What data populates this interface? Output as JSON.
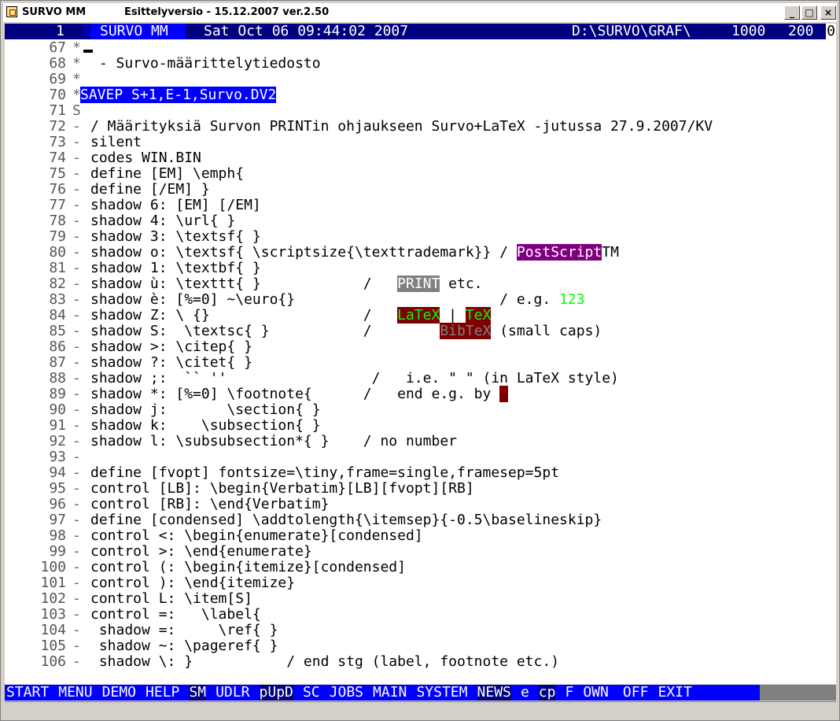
{
  "window": {
    "title_left": "SURVO MM",
    "title_center": "Esittelyversio  - 15.12.2007 ver.2.50",
    "minimize_label": "_",
    "maximize_label": "□",
    "close_label": "×"
  },
  "status_line": {
    "line_number": "1",
    "marker": "1",
    "app_name": "SURVO MM",
    "datetime": "Sat Oct 06 09:44:02 2007",
    "path": "D:\\SURVO\\GRAF\\",
    "col1": "1000",
    "col2": "200",
    "mode": "0"
  },
  "lines": [
    {
      "n": "67",
      "c": "*",
      "t": ""
    },
    {
      "n": "68",
      "c": "*",
      "t": " - Survo-määrittelytiedosto"
    },
    {
      "n": "69",
      "c": "*",
      "t": ""
    },
    {
      "n": "70",
      "c": "*",
      "t": "SAVEP S+1,E-1,Survo.DV2"
    },
    {
      "n": "71",
      "c": "S",
      "t": ""
    },
    {
      "n": "72",
      "c": "-",
      "t": "/ Määrityksiä Survon PRINTin ohjaukseen Survo+LaTeX -jutussa 27.9.2007/KV"
    },
    {
      "n": "73",
      "c": "-",
      "t": "silent"
    },
    {
      "n": "74",
      "c": "-",
      "t": "codes WIN.BIN"
    },
    {
      "n": "75",
      "c": "-",
      "t": "define [EM] \\emph{"
    },
    {
      "n": "76",
      "c": "-",
      "t": "define [/EM] }"
    },
    {
      "n": "77",
      "c": "-",
      "t": "shadow 6: [EM] [/EM]"
    },
    {
      "n": "78",
      "c": "-",
      "t": "shadow 4: \\url{ }"
    },
    {
      "n": "79",
      "c": "-",
      "t": "shadow 3: \\textsf{ }"
    },
    {
      "n": "80",
      "c": "-",
      "t": "shadow o: \\textsf{ \\scriptsize{\\texttrademark}} / ",
      "post": "PostScript",
      "tail": "TM"
    },
    {
      "n": "81",
      "c": "-",
      "t": "shadow 1: \\textbf{ }"
    },
    {
      "n": "82",
      "c": "-",
      "t": "shadow ù: \\texttt{ }            /   ",
      "post": "PRINT",
      "tail": " etc."
    },
    {
      "n": "83",
      "c": "-",
      "t": "shadow è: [%=0] ~\\euro{}                        / e.g. ",
      "post": "123",
      "tail": ""
    },
    {
      "n": "84",
      "c": "-",
      "t": "shadow Z: \\ {}                  /   ",
      "post": "LaTeX",
      "mid": " | ",
      "post2": "TeX"
    },
    {
      "n": "85",
      "c": "-",
      "t": "shadow S:  \\textsc{ }           /        ",
      "post": "BibTeX",
      "tail": " (small caps)"
    },
    {
      "n": "86",
      "c": "-",
      "t": "shadow >: \\citep{ }"
    },
    {
      "n": "87",
      "c": "-",
      "t": "shadow ?: \\citet{ }"
    },
    {
      "n": "88",
      "c": "-",
      "t": "shadow ;:  `` ''                 /   i.e. \" \" (in LaTeX style)"
    },
    {
      "n": "89",
      "c": "-",
      "t": "shadow *: [%=0] \\footnote{      /   end e.g. by ",
      "post": "\\",
      "tail": ""
    },
    {
      "n": "90",
      "c": "-",
      "t": "shadow j:       \\section{ }"
    },
    {
      "n": "91",
      "c": "-",
      "t": "shadow k:    \\subsection{ }"
    },
    {
      "n": "92",
      "c": "-",
      "t": "shadow l: \\subsubsection*{ }    / no number"
    },
    {
      "n": "93",
      "c": "-",
      "t": ""
    },
    {
      "n": "94",
      "c": "-",
      "t": "define [fvopt] fontsize=\\tiny,frame=single,framesep=5pt"
    },
    {
      "n": "95",
      "c": "-",
      "t": "control [LB]: \\begin{Verbatim}[LB][fvopt][RB]"
    },
    {
      "n": "96",
      "c": "-",
      "t": "control [RB]: \\end{Verbatim}"
    },
    {
      "n": "97",
      "c": "-",
      "t": "define [condensed] \\addtolength{\\itemsep}{-0.5\\baselineskip}"
    },
    {
      "n": "98",
      "c": "-",
      "t": "control <: \\begin{enumerate}[condensed]"
    },
    {
      "n": "99",
      "c": "-",
      "t": "control >: \\end{enumerate}"
    },
    {
      "n": "100",
      "c": "-",
      "t": "control (: \\begin{itemize}[condensed]"
    },
    {
      "n": "101",
      "c": "-",
      "t": "control ): \\end{itemize}"
    },
    {
      "n": "102",
      "c": "-",
      "t": "control L: \\item[S]"
    },
    {
      "n": "103",
      "c": "-",
      "t": "control =:   \\label{"
    },
    {
      "n": "104",
      "c": "-",
      "t": " shadow =:     \\ref{ }"
    },
    {
      "n": "105",
      "c": "-",
      "t": " shadow ~: \\pageref{ }"
    },
    {
      "n": "106",
      "c": "-",
      "t": " shadow \\: }           / end stg (label, footnote etc.)"
    }
  ],
  "function_keys": [
    "START",
    "MENU",
    "DEMO",
    "HELP",
    "SM",
    "UDLR",
    "pUpD",
    "SC",
    "JOBS",
    "MAIN",
    "SYSTEM",
    "NEWS",
    "e",
    "cp",
    "F",
    "OWN",
    "OFF",
    "EXIT"
  ],
  "colors": {
    "status_bg": "#000080",
    "highlight_blue": "#0000ff",
    "highlight_purple": "#800080",
    "highlight_gray": "#808080",
    "highlight_darkred": "#7f0000",
    "highlight_green_text": "#00ff00"
  }
}
